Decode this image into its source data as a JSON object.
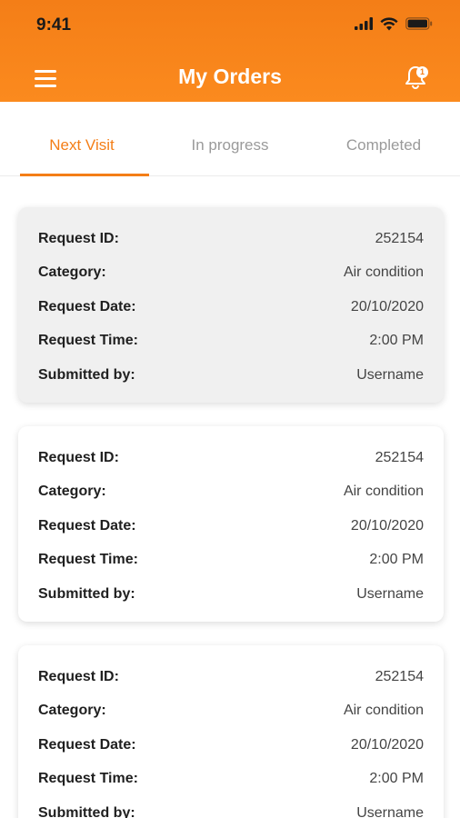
{
  "status_bar": {
    "time": "9:41",
    "icons": [
      "signal-icon",
      "wifi-icon",
      "battery-icon"
    ]
  },
  "header": {
    "title": "My Orders",
    "menu_icon": "hamburger-menu-icon",
    "notification_icon": "bell-icon",
    "notification_count": "1",
    "accent_color": "#f47e17"
  },
  "tabs": [
    {
      "label": "Next Visit",
      "active": true
    },
    {
      "label": "In progress",
      "active": false
    },
    {
      "label": "Completed",
      "active": false
    }
  ],
  "orders": [
    {
      "fields": [
        {
          "label": "Request ID:",
          "value": "252154"
        },
        {
          "label": "Category:",
          "value": "Air condition"
        },
        {
          "label": "Request Date:",
          "value": "20/10/2020"
        },
        {
          "label": "Request Time:",
          "value": "2:00 PM"
        },
        {
          "label": "Submitted by:",
          "value": "Username"
        }
      ]
    },
    {
      "fields": [
        {
          "label": "Request ID:",
          "value": "252154"
        },
        {
          "label": "Category:",
          "value": "Air condition"
        },
        {
          "label": "Request Date:",
          "value": "20/10/2020"
        },
        {
          "label": "Request Time:",
          "value": "2:00 PM"
        },
        {
          "label": "Submitted by:",
          "value": "Username"
        }
      ]
    },
    {
      "fields": [
        {
          "label": "Request ID:",
          "value": "252154"
        },
        {
          "label": "Category:",
          "value": "Air condition"
        },
        {
          "label": "Request Date:",
          "value": "20/10/2020"
        },
        {
          "label": "Request Time:",
          "value": "2:00 PM"
        },
        {
          "label": "Submitted by:",
          "value": "Username"
        }
      ]
    }
  ]
}
